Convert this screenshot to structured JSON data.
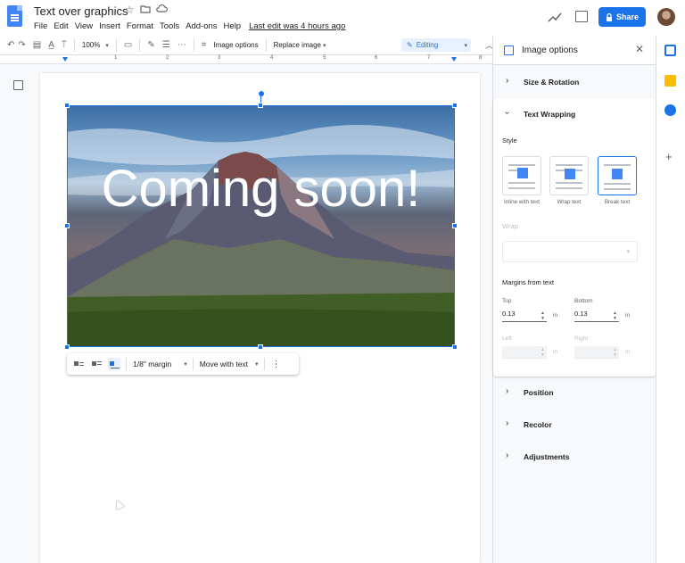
{
  "header": {
    "title": "Text over graphics",
    "menu": [
      "File",
      "Edit",
      "View",
      "Insert",
      "Format",
      "Tools",
      "Add-ons",
      "Help"
    ],
    "last_edit": "Last edit was 4 hours ago",
    "share_label": "Share",
    "icons": [
      "docs-logo-icon",
      "star-icon",
      "folder-icon",
      "cloud-icon",
      "trend-icon",
      "comment-icon",
      "lock-icon",
      "avatar"
    ]
  },
  "toolbar": {
    "zoom": "100%",
    "image_options_label": "Image options",
    "replace_image_label": "Replace image",
    "mode_label": "Editing"
  },
  "ruler": {
    "numbers": [
      "1",
      "2",
      "3",
      "4",
      "5",
      "6",
      "7",
      "8"
    ]
  },
  "image": {
    "overlay_text": "Coming soon!"
  },
  "image_toolbar": {
    "margin_label": "1/8\" margin",
    "move_label": "Move with text"
  },
  "panel": {
    "title": "Image options",
    "sections": {
      "size_rotation": "Size & Rotation",
      "text_wrapping": "Text Wrapping",
      "position": "Position",
      "recolor": "Recolor",
      "adjustments": "Adjustments"
    },
    "style_label": "Style",
    "wrap_options": [
      {
        "label": "Inline with text"
      },
      {
        "label": "Wrap text"
      },
      {
        "label": "Break text"
      }
    ],
    "selected_wrap": "Break text",
    "wrap_label": "Wrap",
    "margins_label": "Margins from text",
    "top_label": "Top",
    "top_value": "0.13",
    "bottom_label": "Bottom",
    "bottom_value": "0.13",
    "left_label": "Left",
    "right_label": "Right",
    "unit": "in"
  },
  "colors": {
    "accent": "#1a73e8",
    "calendar": "#1a73e8",
    "keep": "#fbbc04",
    "tasks": "#1a73e8"
  }
}
